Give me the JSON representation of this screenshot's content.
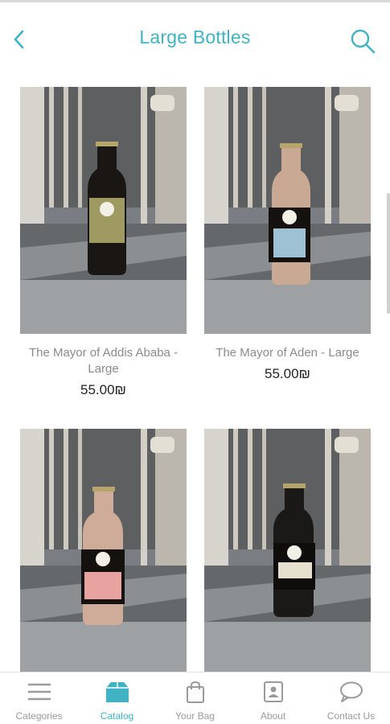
{
  "header": {
    "title": "Large Bottles"
  },
  "products": [
    {
      "name": "The Mayor of Addis Ababa - Large",
      "price": "55.00₪",
      "liquid_color": "#1a1614",
      "label_color": "#9f9a62"
    },
    {
      "name": "The Mayor of Aden - Large",
      "price": "55.00₪",
      "liquid_color": "#c9a993",
      "label_color": "#9ec2d4"
    },
    {
      "name": "",
      "price": "",
      "liquid_color": "#cfab99",
      "label_color": "#e8a3a1"
    },
    {
      "name": "",
      "price": "",
      "liquid_color": "#1b1818",
      "label_color": "#e6e0cf"
    }
  ],
  "tabbar": {
    "items": [
      {
        "label": "Categories",
        "icon": "menu-icon",
        "active": false
      },
      {
        "label": "Catalog",
        "icon": "box-icon",
        "active": true
      },
      {
        "label": "Your Bag",
        "icon": "bag-icon",
        "active": false
      },
      {
        "label": "About",
        "icon": "id-card-icon",
        "active": false
      },
      {
        "label": "Contact Us",
        "icon": "chat-icon",
        "active": false
      }
    ]
  },
  "colors": {
    "accent": "#3fb3c4",
    "inactive": "#9a9a9a"
  }
}
